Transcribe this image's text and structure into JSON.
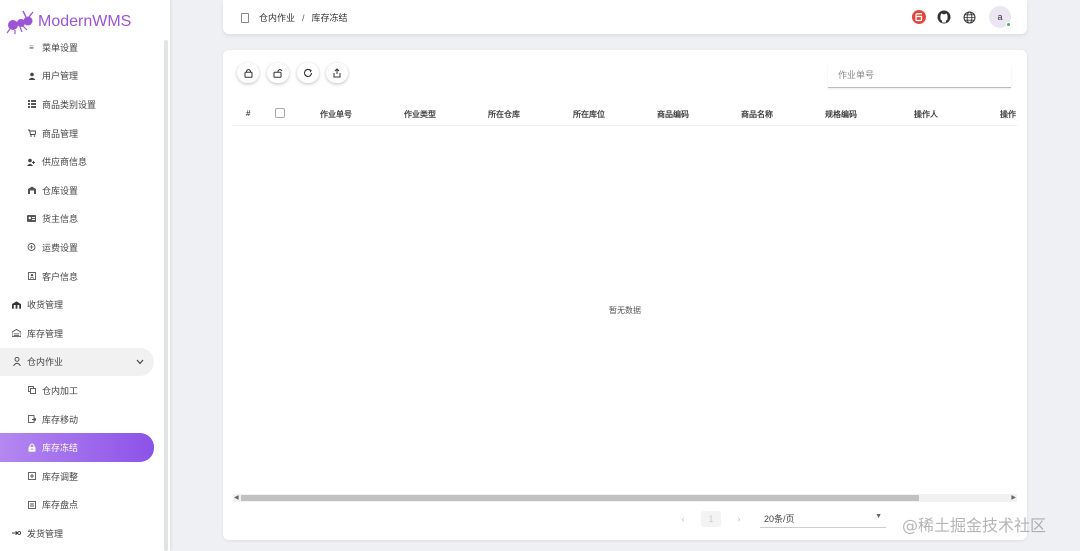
{
  "app": {
    "logo_text": "ModernWMS"
  },
  "sidebar": {
    "items": [
      {
        "label": "菜单设置",
        "icon": "menu-lines-icon",
        "level": "sub"
      },
      {
        "label": "用户管理",
        "icon": "user-icon",
        "level": "sub"
      },
      {
        "label": "商品类别设置",
        "icon": "category-icon",
        "level": "sub"
      },
      {
        "label": "商品管理",
        "icon": "cart-icon",
        "level": "sub"
      },
      {
        "label": "供应商信息",
        "icon": "supplier-icon",
        "level": "sub"
      },
      {
        "label": "仓库设置",
        "icon": "warehouse-icon",
        "level": "sub"
      },
      {
        "label": "货主信息",
        "icon": "owner-card-icon",
        "level": "sub"
      },
      {
        "label": "运费设置",
        "icon": "truck-icon",
        "level": "sub"
      },
      {
        "label": "客户信息",
        "icon": "customer-icon",
        "level": "sub"
      },
      {
        "label": "收货管理",
        "icon": "receive-icon",
        "level": "top"
      },
      {
        "label": "库存管理",
        "icon": "stock-icon",
        "level": "top"
      },
      {
        "label": "仓内作业",
        "icon": "worker-icon",
        "level": "top",
        "expanded": true
      },
      {
        "label": "仓内加工",
        "icon": "process-icon",
        "level": "sub"
      },
      {
        "label": "库存移动",
        "icon": "move-icon",
        "level": "sub"
      },
      {
        "label": "库存冻结",
        "icon": "lock-icon",
        "level": "sub",
        "active": true
      },
      {
        "label": "库存调整",
        "icon": "adjust-icon",
        "level": "sub"
      },
      {
        "label": "库存盘点",
        "icon": "count-icon",
        "level": "sub"
      },
      {
        "label": "发货管理",
        "icon": "ship-icon",
        "level": "top"
      }
    ]
  },
  "header": {
    "breadcrumb_parent": "仓内作业",
    "breadcrumb_sep": "/",
    "breadcrumb_current": "库存冻结",
    "avatar_letter": "a"
  },
  "toolbar": {
    "search_placeholder": "作业单号"
  },
  "table": {
    "columns": [
      "#",
      "作业单号",
      "作业类型",
      "所在仓库",
      "所在库位",
      "商品编码",
      "商品名称",
      "规格编码",
      "操作人",
      "操作"
    ],
    "rows": [],
    "empty_text": "暂无数据"
  },
  "pagination": {
    "current_page": "1",
    "page_size": "20条/页"
  },
  "watermark": "@稀土掘金技术社区",
  "colors": {
    "accent": "#9b55d6",
    "active_gradient_start": "#b488f0",
    "active_gradient_end": "#8c52e8"
  }
}
